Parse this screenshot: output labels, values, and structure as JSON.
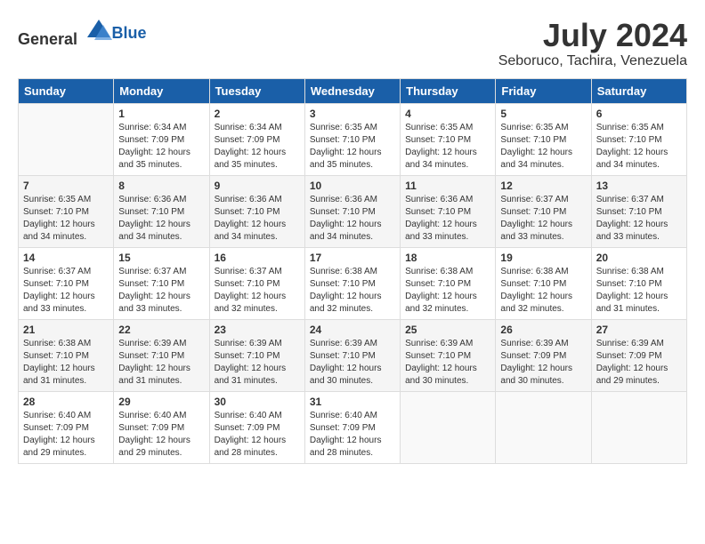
{
  "header": {
    "logo_general": "General",
    "logo_blue": "Blue",
    "month_year": "July 2024",
    "location": "Seboruco, Tachira, Venezuela"
  },
  "days_of_week": [
    "Sunday",
    "Monday",
    "Tuesday",
    "Wednesday",
    "Thursday",
    "Friday",
    "Saturday"
  ],
  "weeks": [
    [
      {
        "day": "",
        "info": ""
      },
      {
        "day": "1",
        "info": "Sunrise: 6:34 AM\nSunset: 7:09 PM\nDaylight: 12 hours\nand 35 minutes."
      },
      {
        "day": "2",
        "info": "Sunrise: 6:34 AM\nSunset: 7:09 PM\nDaylight: 12 hours\nand 35 minutes."
      },
      {
        "day": "3",
        "info": "Sunrise: 6:35 AM\nSunset: 7:10 PM\nDaylight: 12 hours\nand 35 minutes."
      },
      {
        "day": "4",
        "info": "Sunrise: 6:35 AM\nSunset: 7:10 PM\nDaylight: 12 hours\nand 34 minutes."
      },
      {
        "day": "5",
        "info": "Sunrise: 6:35 AM\nSunset: 7:10 PM\nDaylight: 12 hours\nand 34 minutes."
      },
      {
        "day": "6",
        "info": "Sunrise: 6:35 AM\nSunset: 7:10 PM\nDaylight: 12 hours\nand 34 minutes."
      }
    ],
    [
      {
        "day": "7",
        "info": "Sunrise: 6:35 AM\nSunset: 7:10 PM\nDaylight: 12 hours\nand 34 minutes."
      },
      {
        "day": "8",
        "info": "Sunrise: 6:36 AM\nSunset: 7:10 PM\nDaylight: 12 hours\nand 34 minutes."
      },
      {
        "day": "9",
        "info": "Sunrise: 6:36 AM\nSunset: 7:10 PM\nDaylight: 12 hours\nand 34 minutes."
      },
      {
        "day": "10",
        "info": "Sunrise: 6:36 AM\nSunset: 7:10 PM\nDaylight: 12 hours\nand 34 minutes."
      },
      {
        "day": "11",
        "info": "Sunrise: 6:36 AM\nSunset: 7:10 PM\nDaylight: 12 hours\nand 33 minutes."
      },
      {
        "day": "12",
        "info": "Sunrise: 6:37 AM\nSunset: 7:10 PM\nDaylight: 12 hours\nand 33 minutes."
      },
      {
        "day": "13",
        "info": "Sunrise: 6:37 AM\nSunset: 7:10 PM\nDaylight: 12 hours\nand 33 minutes."
      }
    ],
    [
      {
        "day": "14",
        "info": "Sunrise: 6:37 AM\nSunset: 7:10 PM\nDaylight: 12 hours\nand 33 minutes."
      },
      {
        "day": "15",
        "info": "Sunrise: 6:37 AM\nSunset: 7:10 PM\nDaylight: 12 hours\nand 33 minutes."
      },
      {
        "day": "16",
        "info": "Sunrise: 6:37 AM\nSunset: 7:10 PM\nDaylight: 12 hours\nand 32 minutes."
      },
      {
        "day": "17",
        "info": "Sunrise: 6:38 AM\nSunset: 7:10 PM\nDaylight: 12 hours\nand 32 minutes."
      },
      {
        "day": "18",
        "info": "Sunrise: 6:38 AM\nSunset: 7:10 PM\nDaylight: 12 hours\nand 32 minutes."
      },
      {
        "day": "19",
        "info": "Sunrise: 6:38 AM\nSunset: 7:10 PM\nDaylight: 12 hours\nand 32 minutes."
      },
      {
        "day": "20",
        "info": "Sunrise: 6:38 AM\nSunset: 7:10 PM\nDaylight: 12 hours\nand 31 minutes."
      }
    ],
    [
      {
        "day": "21",
        "info": "Sunrise: 6:38 AM\nSunset: 7:10 PM\nDaylight: 12 hours\nand 31 minutes."
      },
      {
        "day": "22",
        "info": "Sunrise: 6:39 AM\nSunset: 7:10 PM\nDaylight: 12 hours\nand 31 minutes."
      },
      {
        "day": "23",
        "info": "Sunrise: 6:39 AM\nSunset: 7:10 PM\nDaylight: 12 hours\nand 31 minutes."
      },
      {
        "day": "24",
        "info": "Sunrise: 6:39 AM\nSunset: 7:10 PM\nDaylight: 12 hours\nand 30 minutes."
      },
      {
        "day": "25",
        "info": "Sunrise: 6:39 AM\nSunset: 7:10 PM\nDaylight: 12 hours\nand 30 minutes."
      },
      {
        "day": "26",
        "info": "Sunrise: 6:39 AM\nSunset: 7:09 PM\nDaylight: 12 hours\nand 30 minutes."
      },
      {
        "day": "27",
        "info": "Sunrise: 6:39 AM\nSunset: 7:09 PM\nDaylight: 12 hours\nand 29 minutes."
      }
    ],
    [
      {
        "day": "28",
        "info": "Sunrise: 6:40 AM\nSunset: 7:09 PM\nDaylight: 12 hours\nand 29 minutes."
      },
      {
        "day": "29",
        "info": "Sunrise: 6:40 AM\nSunset: 7:09 PM\nDaylight: 12 hours\nand 29 minutes."
      },
      {
        "day": "30",
        "info": "Sunrise: 6:40 AM\nSunset: 7:09 PM\nDaylight: 12 hours\nand 28 minutes."
      },
      {
        "day": "31",
        "info": "Sunrise: 6:40 AM\nSunset: 7:09 PM\nDaylight: 12 hours\nand 28 minutes."
      },
      {
        "day": "",
        "info": ""
      },
      {
        "day": "",
        "info": ""
      },
      {
        "day": "",
        "info": ""
      }
    ]
  ]
}
